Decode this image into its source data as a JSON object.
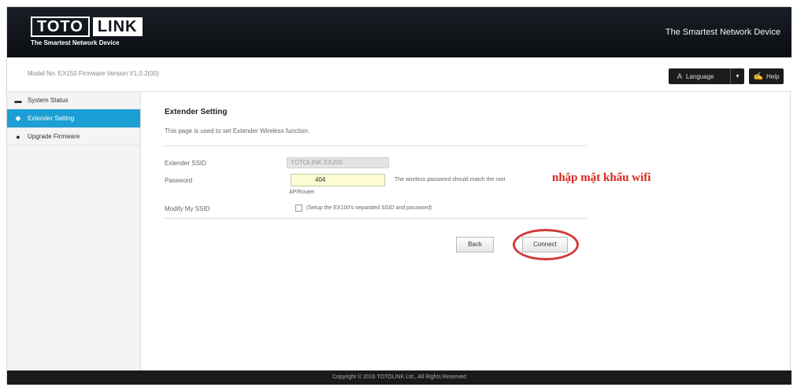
{
  "header": {
    "logo_left": "TOTO",
    "logo_right": "LINK",
    "logo_tagline": "The Smartest Network Device",
    "slogan": "The Smartest Network Device"
  },
  "infobar": {
    "model_text": "Model No. EX150  Firmware Version V1.0.2(00)",
    "language_label": "Language",
    "help_label": "Help"
  },
  "sidebar": {
    "items": [
      {
        "label": "System Status",
        "icon": "monitor-icon",
        "active": false
      },
      {
        "label": "Extender Setting",
        "icon": "wifi-icon",
        "active": true
      },
      {
        "label": "Upgrade Firmware",
        "icon": "upgrade-icon",
        "active": false
      }
    ]
  },
  "main": {
    "title": "Extender Setting",
    "description": "This page is used to set Extender Wireless function.",
    "ssid_label": "Extender SSID",
    "ssid_value": "TOTOLINK EX200",
    "password_label": "Password",
    "password_value": "404",
    "password_note": "The wireless password should match the root",
    "password_note2": "AP/Router.",
    "modify_label": "Modify My SSID",
    "modify_checkbox_label": "(Setup the EX100's separated SSID and password)",
    "annotation": "nhập mật khẩu wifi",
    "back_label": "Back",
    "connect_label": "Connect"
  },
  "footer": {
    "copyright": "Copyright © 2016 TOTOLINK Ltd.,  All Rights Reserved"
  },
  "colors": {
    "header_bg": "#0b0e12",
    "active_item": "#1b9fd4",
    "annotation": "#d9241b",
    "password_field": "#fdfbd2"
  }
}
